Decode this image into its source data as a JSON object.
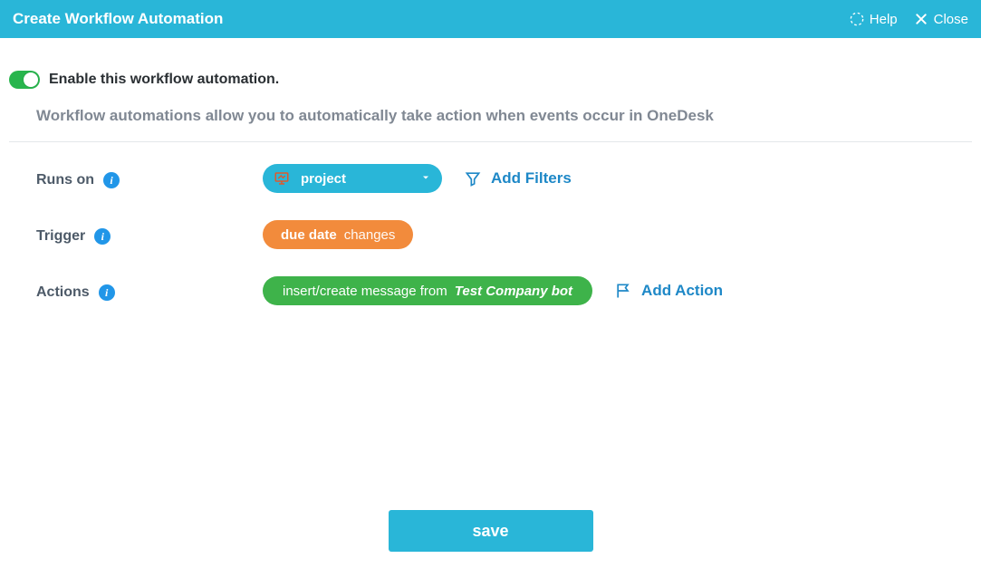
{
  "header": {
    "title": "Create Workflow Automation",
    "help": "Help",
    "close": "Close"
  },
  "enable_label": "Enable this workflow automation.",
  "description": "Workflow automations allow you to automatically take action when events occur in OneDesk",
  "runs_on": {
    "label": "Runs on",
    "selected": "project",
    "add_filters": "Add Filters"
  },
  "trigger": {
    "label": "Trigger",
    "field": "due date",
    "op": "changes"
  },
  "actions": {
    "label": "Actions",
    "text": "insert/create message from",
    "from": "Test Company bot",
    "add_action": "Add Action"
  },
  "save": "save",
  "colors": {
    "brand": "#29b6d8"
  }
}
